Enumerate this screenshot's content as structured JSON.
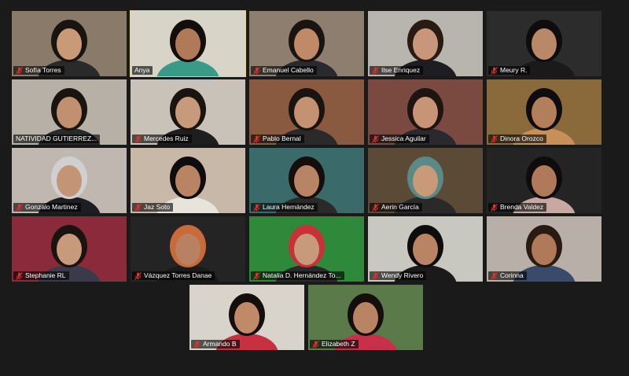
{
  "gallery": {
    "active_speaker_color": "#e8d84a",
    "muted_icon": "microphone-muted-icon",
    "muted_icon_color": "#e0302a",
    "participants": [
      {
        "name": "Sofía Torres",
        "muted": true,
        "active": false,
        "bg": "#8a7a6a",
        "skin": "#c89a78",
        "hair": "#1a1410",
        "shirt": "#2a2a2a"
      },
      {
        "name": "Anya",
        "muted": false,
        "active": true,
        "bg": "#d8d4c8",
        "skin": "#b07a58",
        "hair": "#120e0c",
        "shirt": "#3a9a88"
      },
      {
        "name": "Emanuel Cabello",
        "muted": true,
        "active": false,
        "bg": "#8e7e70",
        "skin": "#c08a68",
        "hair": "#1a1410",
        "shirt": "#2a2a2e"
      },
      {
        "name": "Ilse Enriquez",
        "muted": true,
        "active": false,
        "bg": "#b8b4ae",
        "skin": "#c8967a",
        "hair": "#2a1a14",
        "shirt": "#1e1e22"
      },
      {
        "name": "Meury R.",
        "muted": true,
        "active": false,
        "bg": "#2c2c2c",
        "skin": "#b88868",
        "hair": "#0e0c0c",
        "shirt": "#1a1a1a"
      },
      {
        "name": "NATIVIDAD GUTIERREZ...",
        "muted": false,
        "active": false,
        "bg": "#b6b0a6",
        "skin": "#c09070",
        "hair": "#1a1410",
        "shirt": "#2a2a2a"
      },
      {
        "name": "Mercedes Ruiz",
        "muted": true,
        "active": false,
        "bg": "#c8c2b8",
        "skin": "#c89a7c",
        "hair": "#1a1410",
        "shirt": "#1e1e1e"
      },
      {
        "name": "Pablo Bernal",
        "muted": true,
        "active": false,
        "bg": "#8a5a40",
        "skin": "#c49272",
        "hair": "#1a1410",
        "shirt": "#2a2a2a"
      },
      {
        "name": "Jessica Aguilar",
        "muted": true,
        "active": false,
        "bg": "#7a4a40",
        "skin": "#c89478",
        "hair": "#1e1410",
        "shirt": "#2a2a2e"
      },
      {
        "name": "Dinora Orozco",
        "muted": true,
        "active": false,
        "bg": "#8a6a3a",
        "skin": "#b27e5c",
        "hair": "#0e0c0c",
        "shirt": "#c89058"
      },
      {
        "name": "Gonzalo Martinez",
        "muted": true,
        "active": false,
        "bg": "#c0b8b0",
        "skin": "#c49476",
        "hair": "#d0d0d0",
        "shirt": "#1e1e22"
      },
      {
        "name": "Jaz Soto",
        "muted": true,
        "active": false,
        "bg": "#c8b8a8",
        "skin": "#b88464",
        "hair": "#0e0c0c",
        "shirt": "#e8e4dc"
      },
      {
        "name": "Laura Hernández",
        "muted": true,
        "active": false,
        "bg": "#3a6a6a",
        "skin": "#b88466",
        "hair": "#140e0c",
        "shirt": "#2a2a2a"
      },
      {
        "name": "Aerin García",
        "muted": true,
        "active": false,
        "bg": "#5a4a36",
        "skin": "#c89a7a",
        "hair": "#5a8a86",
        "shirt": "#2a2a2a"
      },
      {
        "name": "Brenda Valdez",
        "muted": true,
        "active": false,
        "bg": "#242424",
        "skin": "#b07a5a",
        "hair": "#0e0c0c",
        "shirt": "#c8a8a0"
      },
      {
        "name": "Stephanie RL",
        "muted": true,
        "active": false,
        "bg": "#8a2a3a",
        "skin": "#c89a7c",
        "hair": "#1a1410",
        "shirt": "#3a3a4a"
      },
      {
        "name": "Vázquez Torres Danae",
        "muted": true,
        "active": false,
        "bg": "#242424",
        "skin": "#b88262",
        "hair": "#c86a3a",
        "shirt": "#1a1a1a"
      },
      {
        "name": "Natalia D. Hernández To...",
        "muted": true,
        "active": false,
        "bg": "#2e8a3a",
        "skin": "#c89a7c",
        "hair": "#c8303a",
        "shirt": "#2a2a2a"
      },
      {
        "name": "Wendy Rivero",
        "muted": true,
        "active": false,
        "bg": "#c8c8c0",
        "skin": "#b88464",
        "hair": "#0e0c0c",
        "shirt": "#1a1a1a"
      },
      {
        "name": "Corinna",
        "muted": true,
        "active": false,
        "bg": "#b8b0a8",
        "skin": "#b07a5a",
        "hair": "#2a1a12",
        "shirt": "#3a4a6a"
      },
      {
        "name": "Armando B",
        "muted": true,
        "active": false,
        "bg": "#d8d4cc",
        "skin": "#c08a68",
        "hair": "#140e0c",
        "shirt": "#c83040"
      },
      {
        "name": "Elizabeth Z",
        "muted": true,
        "active": false,
        "bg": "#5a7a4a",
        "skin": "#b88464",
        "hair": "#140e0c",
        "shirt": "#c8304a"
      }
    ]
  }
}
